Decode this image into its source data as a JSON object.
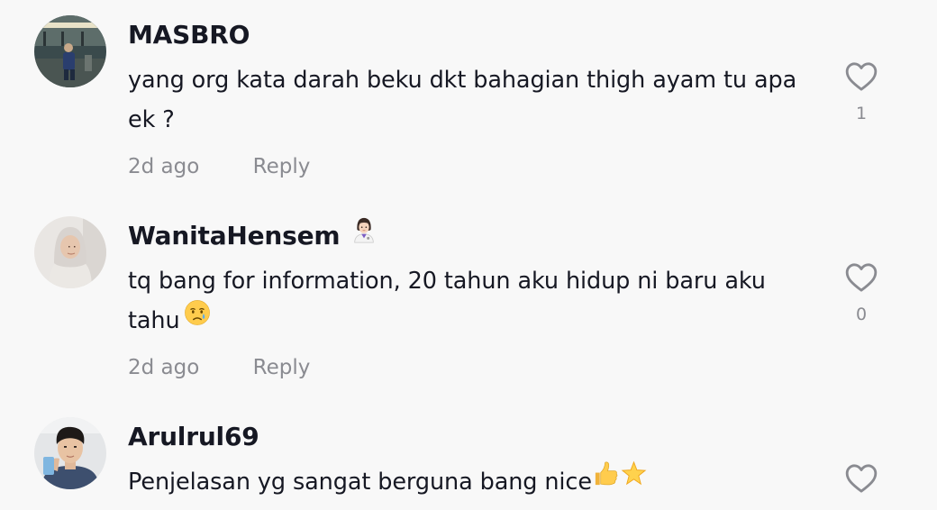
{
  "comments": [
    {
      "username": "MASBRO",
      "username_emoji": "",
      "text": "yang org kata darah beku dkt bahagian thigh ayam tu apa ek ?",
      "time": "2d ago",
      "reply_label": "Reply",
      "likes": "1"
    },
    {
      "username": "WanitaHensem",
      "username_emoji": "woman-health-worker-emoji",
      "text": "tq bang for information, 20 tahun aku hidup ni baru aku tahu",
      "text_emoji": "crying-face-emoji",
      "time": "2d ago",
      "reply_label": "Reply",
      "likes": "0"
    },
    {
      "username": "Arulrul69",
      "username_emoji": "",
      "text": "Penjelasan yg sangat berguna bang nice",
      "text_emoji": "thumbs-up-and-star-emoji",
      "time": "",
      "reply_label": "",
      "likes": ""
    }
  ],
  "icons": {
    "like": "heart-outline-icon"
  },
  "colors": {
    "background": "#f8f8f8",
    "primary_text": "#161823",
    "secondary_text": "#8a8b91",
    "icon": "#8a8b91"
  }
}
